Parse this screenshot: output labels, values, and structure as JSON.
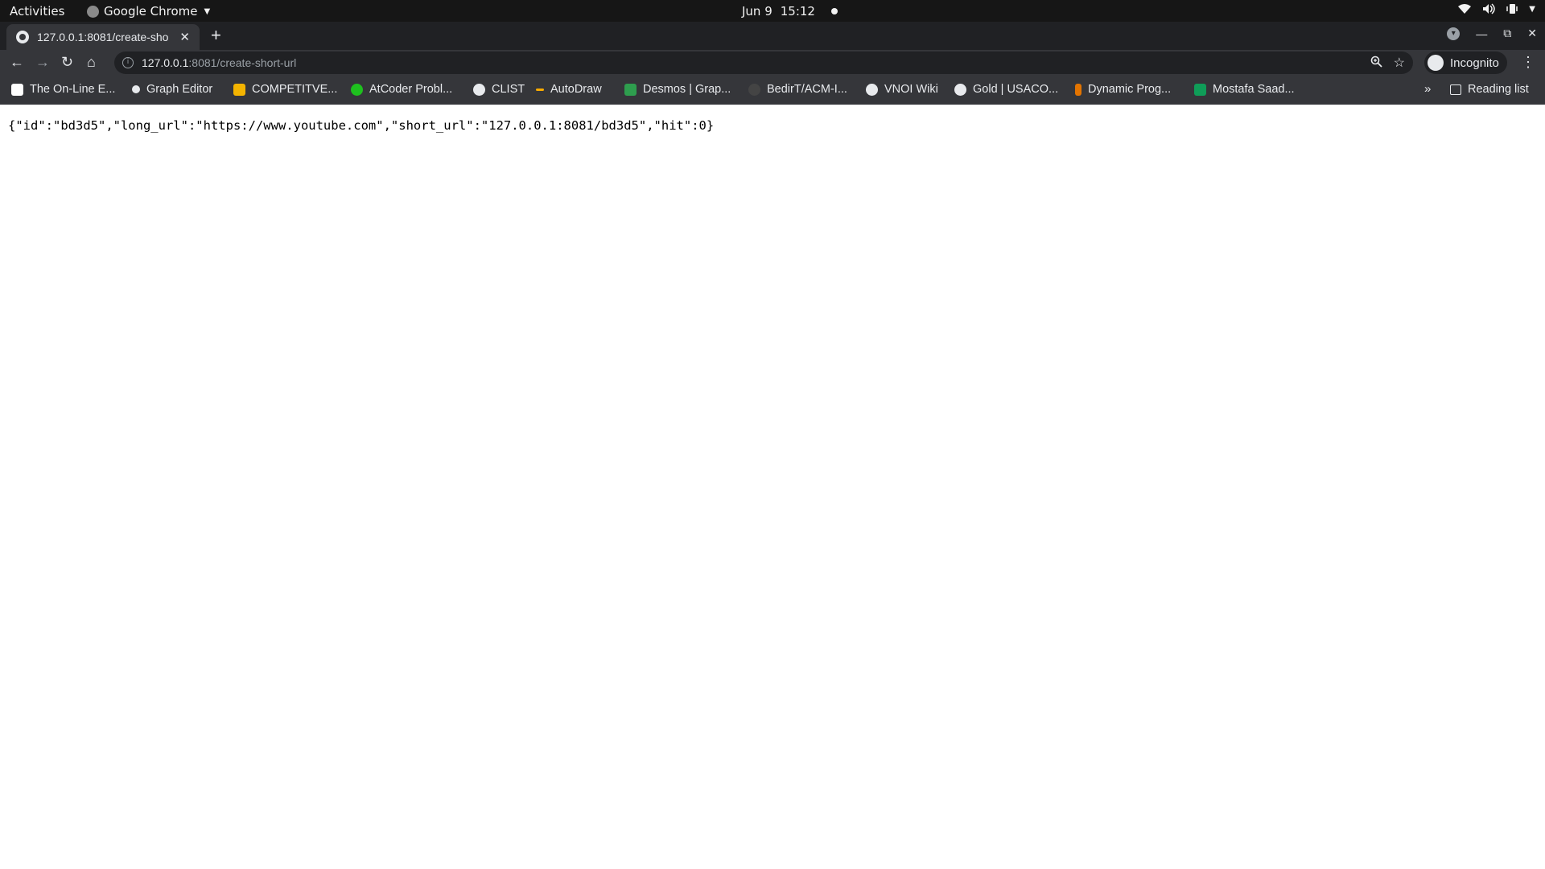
{
  "os": {
    "activities": "Activities",
    "app_name": "Google Chrome",
    "date": "Jun 9",
    "time": "15:12"
  },
  "tab": {
    "title": "127.0.0.1:8081/create-sho",
    "close": "✕",
    "new_tab": "+"
  },
  "address": {
    "host": "127.0.0.1",
    "path": ":8081/create-short-url"
  },
  "profile": {
    "label": "Incognito"
  },
  "bookmarks": [
    {
      "label": "The On-Line E...",
      "icon": "oeis-icon",
      "color": "#ffffff"
    },
    {
      "label": "Graph Editor",
      "icon": "graph-editor-icon",
      "color": "#e8eaed"
    },
    {
      "label": "COMPETITVE...",
      "icon": "google-drive-icon",
      "color": "#f4b400"
    },
    {
      "label": "AtCoder Probl...",
      "icon": "atcoder-icon",
      "color": "#1ec01e"
    },
    {
      "label": "CLIST",
      "icon": "globe-icon",
      "color": "#e8eaed"
    },
    {
      "label": "AutoDraw",
      "icon": "autodraw-icon",
      "color": "#f9ab00"
    },
    {
      "label": "Desmos | Grap...",
      "icon": "desmos-icon",
      "color": "#2e9e4e"
    },
    {
      "label": "BedirT/ACM-I...",
      "icon": "github-icon",
      "color": "#444444"
    },
    {
      "label": "VNOI Wiki",
      "icon": "globe-icon",
      "color": "#e8eaed"
    },
    {
      "label": "Gold | USACO...",
      "icon": "usaco-icon",
      "color": "#e8eaed"
    },
    {
      "label": "Dynamic Prog...",
      "icon": "dp-icon",
      "color": "#e37400"
    },
    {
      "label": "Mostafa Saad...",
      "icon": "google-sheets-icon",
      "color": "#0f9d58"
    }
  ],
  "bookmarks_overflow": "»",
  "reading_list": "Reading list",
  "body_text": "{\"id\":\"bd3d5\",\"long_url\":\"https://www.youtube.com\",\"short_url\":\"127.0.0.1:8081/bd3d5\",\"hit\":0}"
}
